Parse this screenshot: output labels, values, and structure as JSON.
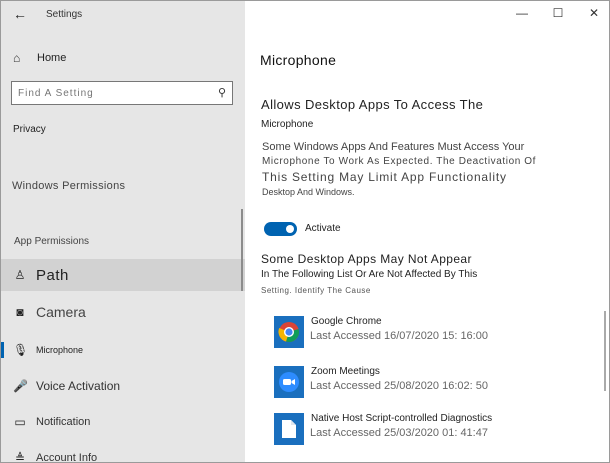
{
  "window": {
    "title": "Settings",
    "back_icon": "←",
    "controls": [
      "—",
      "☐",
      "✕"
    ]
  },
  "sidebar": {
    "home_label": "Home",
    "search_placeholder": "Find A Setting",
    "privacy_label": "Privacy",
    "windows_permissions_label": "Windows Permissions",
    "app_permissions_label": "App Permissions",
    "items": [
      {
        "label": "Path",
        "icon": "location-icon"
      },
      {
        "label": "Camera",
        "icon": "camera-icon"
      },
      {
        "label": "Microphone",
        "icon": "microphone-icon",
        "selected": true
      },
      {
        "label": "Voice Activation",
        "icon": "voice-activation-icon"
      },
      {
        "label": "Notification",
        "icon": "notification-icon"
      },
      {
        "label": "Account Info",
        "icon": "account-info-icon"
      }
    ]
  },
  "main": {
    "title": "Microphone",
    "section_title_line1": "Allows Desktop Apps To Access The",
    "section_title_line2": "Microphone",
    "description": {
      "line1": "Some Windows Apps And Features Must Access Your",
      "line2": "Microphone To Work As Expected. The Deactivation Of",
      "line3": "This Setting May Limit App Functionality",
      "line4": "Desktop And Windows."
    },
    "toggle": {
      "state": "on",
      "label": "Activate"
    },
    "note": {
      "line1": "Some Desktop Apps May Not Appear",
      "line2": "In The Following List Or Are Not Affected By This",
      "line3": "Setting. Identify The Cause"
    },
    "apps": [
      {
        "name": "Google Chrome",
        "last_accessed": "Last Accessed 16/07/2020 15: 16:00",
        "icon": "chrome-icon"
      },
      {
        "name": "Zoom Meetings",
        "last_accessed": "Last Accessed 25/08/2020 16:02: 50",
        "icon": "zoom-icon"
      },
      {
        "name": "Native Host Script-controlled Diagnostics",
        "last_accessed": "Last Accessed 25/03/2020 01: 41:47",
        "icon": "document-icon"
      }
    ]
  },
  "colors": {
    "accent": "#0063b1",
    "sidebar_bg": "#e6e6e6",
    "selected_bg": "#d2d2d2"
  }
}
